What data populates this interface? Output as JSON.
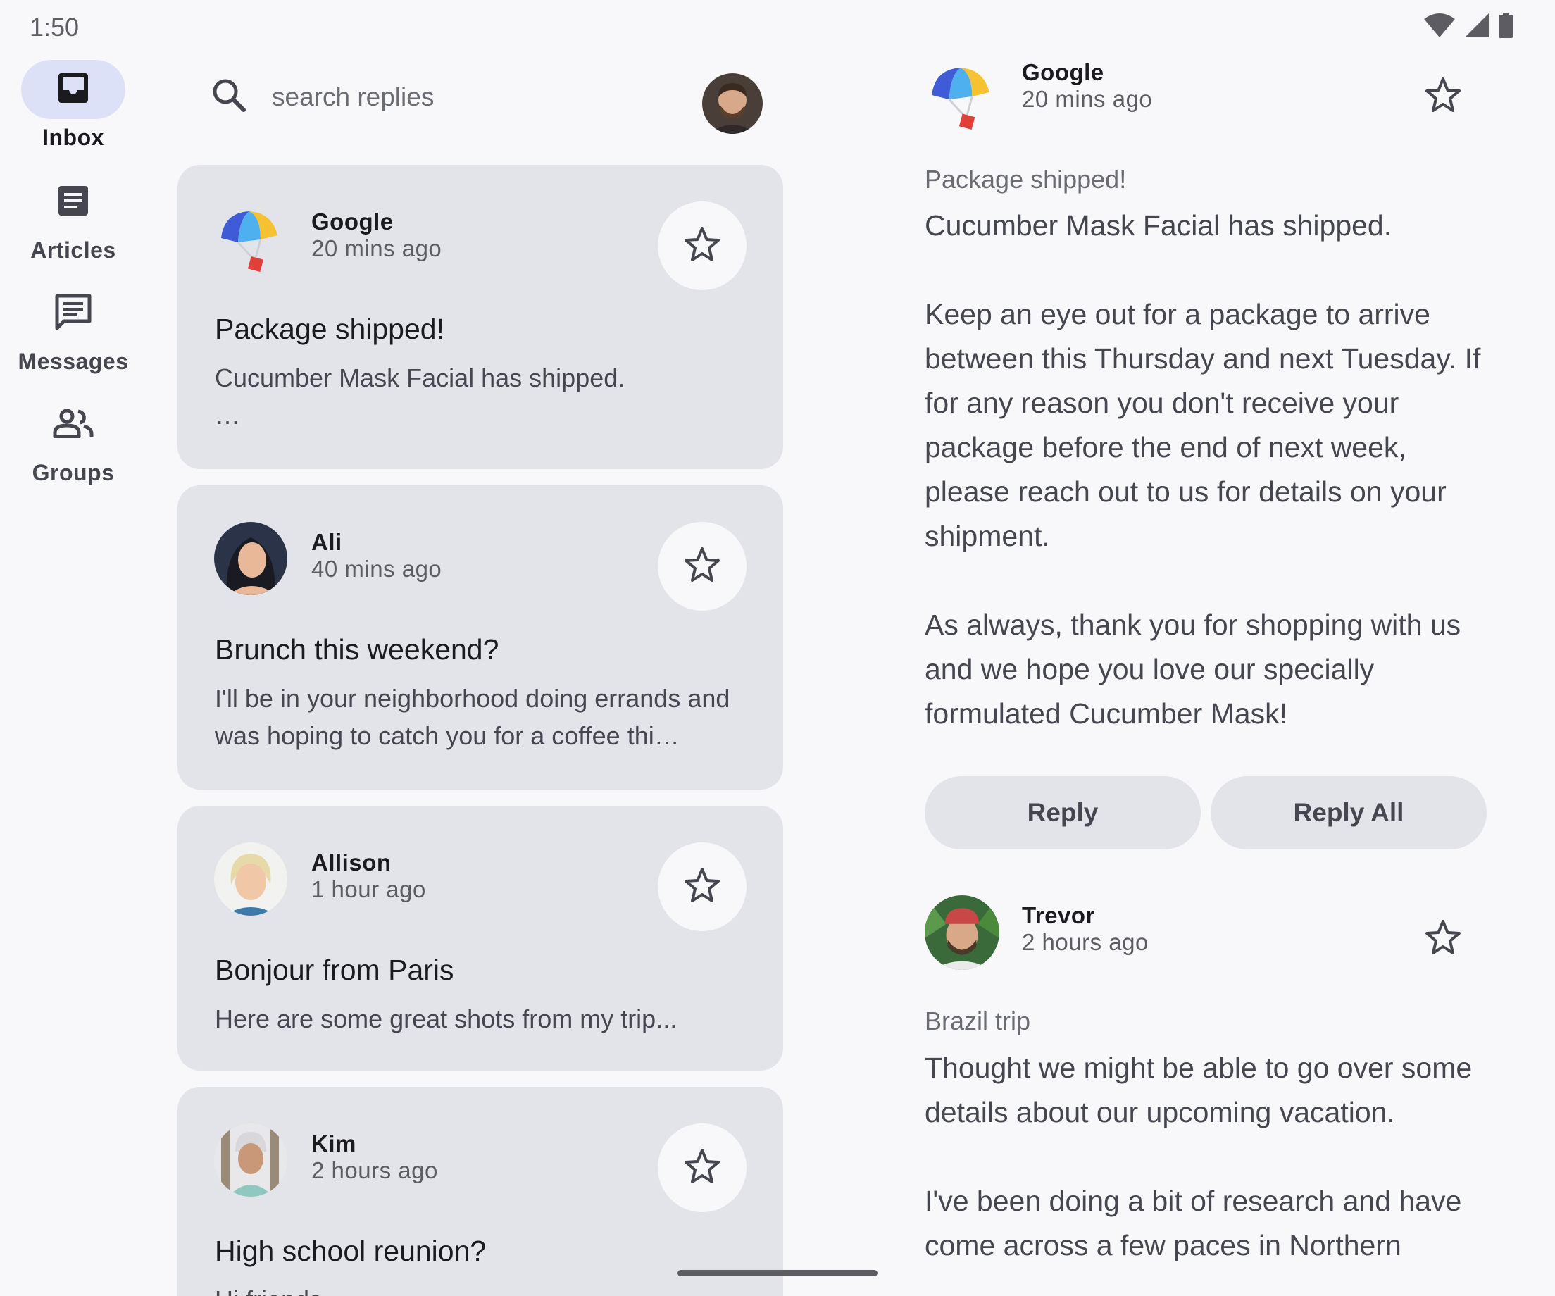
{
  "status_bar": {
    "time": "1:50",
    "icons": [
      "wifi-icon",
      "signal-icon",
      "battery-icon"
    ]
  },
  "nav_rail": {
    "items": [
      {
        "label": "Inbox",
        "icon": "inbox-icon",
        "active": true
      },
      {
        "label": "Articles",
        "icon": "article-icon",
        "active": false
      },
      {
        "label": "Messages",
        "icon": "chat-icon",
        "active": false
      },
      {
        "label": "Groups",
        "icon": "groups-icon",
        "active": false
      }
    ]
  },
  "search": {
    "placeholder": "search replies"
  },
  "emails": [
    {
      "sender": "Google",
      "time": "20 mins ago",
      "subject": "Package shipped!",
      "preview": "Cucumber Mask Facial has shipped.\n…"
    },
    {
      "sender": "Ali",
      "time": "40 mins ago",
      "subject": "Brunch this weekend?",
      "preview": "I'll be in your neighborhood doing errands and was hoping to catch you for a coffee thi…"
    },
    {
      "sender": "Allison",
      "time": "1 hour ago",
      "subject": "Bonjour from Paris",
      "preview": "Here are some great shots from my trip..."
    },
    {
      "sender": "Kim",
      "time": "2 hours ago",
      "subject": "High school reunion?",
      "preview": "Hi friends,"
    }
  ],
  "detail": {
    "messages": [
      {
        "sender": "Google",
        "time": "20 mins ago",
        "subject": "Package shipped!",
        "body": "Cucumber Mask Facial has shipped.\n\nKeep an eye out for a package to arrive between this Thursday and next Tuesday. If for any reason you don't receive your package before the end of next week, please reach out to us for details on your shipment.\n\nAs always, thank you for shopping with us and we hope you love our specially formulated Cucumber Mask!"
      },
      {
        "sender": "Trevor",
        "time": "2 hours ago",
        "subject": "Brazil trip",
        "body": "Thought we might be able to go over some details about our upcoming vacation.\n\nI've been doing a bit of research and have come across a few paces in Northern"
      }
    ],
    "reply_label": "Reply",
    "reply_all_label": "Reply All"
  },
  "colors": {
    "background": "#f8f8fb",
    "card": "#e3e3ea",
    "active_indicator": "#dde1f7",
    "text_secondary": "#45464f"
  }
}
